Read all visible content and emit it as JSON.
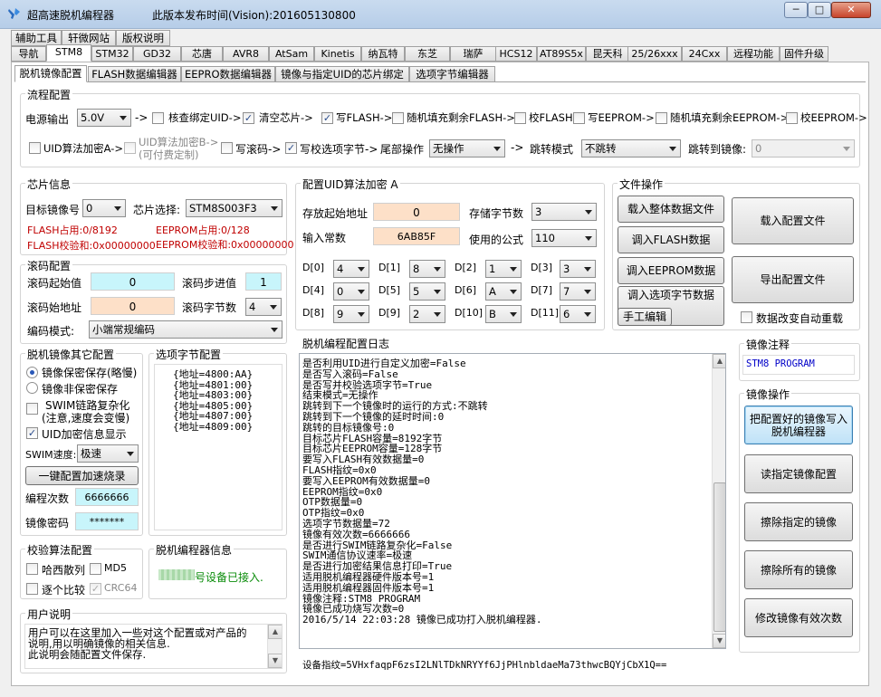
{
  "window": {
    "title": "超高速脱机编程器",
    "vision": "此版本发布时间(Vision):201605130800",
    "minimize": "─",
    "maximize": "□",
    "close": "✕"
  },
  "tabs_row1": [
    "辅助工具",
    "轩微网站",
    "版权说明"
  ],
  "tabs_row2": [
    "导航",
    "STM8",
    "STM32",
    "GD32",
    "芯唐",
    "AVR8",
    "AtSam",
    "Kinetis",
    "纳瓦特",
    "东芝",
    "瑞萨",
    "HCS12",
    "AT89S5x",
    "昆天科",
    "25/26xxx",
    "24Cxx",
    "远程功能",
    "固件升级"
  ],
  "tabs_row3": [
    "脱机镜像配置",
    "FLASH数据编辑器",
    "EEPRO数据编辑器",
    "镜像与指定UID的芯片绑定",
    "选项字节编辑器"
  ],
  "flow": {
    "title": "流程配置",
    "power_label": "电源输出",
    "power_value": "5.0V",
    "arrow": "->",
    "steps_row1": [
      {
        "label": "核查绑定UID->",
        "checked": false
      },
      {
        "label": "清空芯片->",
        "checked": true
      },
      {
        "label": "写FLASH->",
        "checked": true
      },
      {
        "label": "随机填充剩余FLASH->",
        "checked": false
      },
      {
        "label": "校FLASH->",
        "checked": false
      },
      {
        "label": "写EEPROM->",
        "checked": false
      },
      {
        "label": "随机填充剩余EEPROM->",
        "checked": false
      },
      {
        "label": "校EEPROM->",
        "checked": false
      }
    ],
    "uid_encrypt_a": "UID算法加密A->",
    "uid_encrypt_b_line1": "UID算法加密B->",
    "uid_encrypt_b_line2": "(可付费定制)",
    "write_roll": "写滚码->",
    "write_option": "写校选项字节->",
    "tail_label": "尾部操作",
    "tail_value": "无操作",
    "jump_mode_label": "跳转模式",
    "jump_mode_value": "不跳转",
    "jump_to_label": "跳转到镜像:",
    "jump_to_value": "0"
  },
  "chip": {
    "title": "芯片信息",
    "target_label": "目标镜像号",
    "target_value": "0",
    "chip_label": "芯片选择:",
    "chip_value": "STM8S003F3",
    "flash_used": "FLASH占用:0/8192",
    "eeprom_used": "EEPROM占用:0/128",
    "flash_checksum": "FLASH校验和:0x00000000",
    "eeprom_checksum": "EEPROM校验和:0x00000000"
  },
  "rolling": {
    "title": "滚码配置",
    "start_label": "滚码起始值",
    "start_value": "0",
    "step_label": "滚码步进值",
    "step_value": "1",
    "addr_label": "滚码始地址",
    "addr_value": "0",
    "bytes_label": "滚码字节数",
    "bytes_value": "4",
    "mode_label": "编码模式:",
    "mode_value": "小端常规编码"
  },
  "uid_cfg": {
    "title": "配置UID算法加密 A",
    "addr_label": "存放起始地址",
    "addr_value": "0",
    "bytes_label": "存储字节数",
    "bytes_value": "3",
    "const_label": "输入常数",
    "const_value": "6AB85F",
    "formula_label": "使用的公式",
    "formula_value": "110",
    "d": [
      {
        "label": "D[0]",
        "value": "4"
      },
      {
        "label": "D[1]",
        "value": "8"
      },
      {
        "label": "D[2]",
        "value": "1"
      },
      {
        "label": "D[3]",
        "value": "3"
      },
      {
        "label": "D[4]",
        "value": "0"
      },
      {
        "label": "D[5]",
        "value": "5"
      },
      {
        "label": "D[6]",
        "value": "A"
      },
      {
        "label": "D[7]",
        "value": "7"
      },
      {
        "label": "D[8]",
        "value": "9"
      },
      {
        "label": "D[9]",
        "value": "2"
      },
      {
        "label": "D[10]",
        "value": "B"
      },
      {
        "label": "D[11]",
        "value": "6"
      }
    ]
  },
  "file_ops": {
    "title": "文件操作",
    "load_all": "载入整体数据文件",
    "load_flash": "调入FLASH数据",
    "load_eeprom": "调入EEPROM数据",
    "load_option": "调入选项字节数据",
    "manual_edit": "手工编辑",
    "load_config": "载入配置文件",
    "export_config": "导出配置文件",
    "auto_reload": "数据改变自动重载"
  },
  "other": {
    "title": "脱机镜像其它配置",
    "keep_protect": "镜像保密保存(略慢)",
    "no_protect": "镜像非保密保存",
    "swim_line1": "SWIM链路复杂化",
    "swim_line2": "(注意,速度会变慢)",
    "uid_show": "UID加密信息显示",
    "swim_speed_label": "SWIM速度:",
    "swim_speed_value": "极速",
    "one_key": "一键配置加速烧录",
    "count_label": "编程次数",
    "count_value": "6666666",
    "pwd_label": "镜像密码",
    "pwd_value": "*******"
  },
  "option_bytes": {
    "title": "选项字节配置",
    "lines": [
      "{地址=4800:AA}",
      "{地址=4801:00}",
      "{地址=4803:00}",
      "{地址=4805:00}",
      "{地址=4807:00}",
      "{地址=4809:00}"
    ]
  },
  "log": {
    "title": "脱机编程配置日志",
    "lines": [
      "是否利用UID进行自定义加密=False",
      "是否写入滚码=False",
      "是否写并校验选项字节=True",
      "结束模式=无操作",
      "跳转到下一个镜像时的运行的方式:不跳转",
      "跳转到下一个镜像的延时时间:0",
      "跳转的目标镜像号:0",
      "目标芯片FLASH容量=8192字节",
      "目标芯片EEPROM容量=128字节",
      "要写入FLASH有效数据量=0",
      "FLASH指纹=0x0",
      "要写入EEPROM有效数据量=0",
      "EEPROM指纹=0x0",
      "OTP数据量=0",
      "OTP指纹=0x0",
      "选项字节数据量=72",
      "镜像有效次数=6666666",
      "是否进行SWIM链路复杂化=False",
      "SWIM通信协议速率=极速",
      "是否进行加密结果信息打印=True",
      "适用脱机编程器硬件版本号=1",
      "适用脱机编程器固件版本号=1",
      "镜像注释:STM8 PROGRAM",
      "镜像已成功烧写次数=0",
      "2016/5/14 22:03:28 镜像已成功打入脱机编程器."
    ],
    "fingerprint": "设备指纹=5VHxfaqpF6zsI2LNlTDkNRYYf6JjPHlnbldaeMa73thwcBQYjCbX1Q=="
  },
  "verify": {
    "title": "校验算法配置",
    "hash": "哈西散列",
    "md5": "MD5",
    "compare": "逐个比较",
    "crc64": "CRC64"
  },
  "programmer": {
    "title": "脱机编程器信息",
    "status": "号设备已接入."
  },
  "usage": {
    "title": "用户说明",
    "lines": [
      "用户可以在这里加入一些对这个配置或对产品的",
      "说明,用以明确镜像的相关信息.",
      "此说明会随配置文件保存."
    ]
  },
  "image_note": {
    "title": "镜像注释",
    "value": "STM8 PROGRAM"
  },
  "image_ops": {
    "title": "镜像操作",
    "write_line1": "把配置好的镜像写入",
    "write_line2": "脱机编程器",
    "read": "读指定镜像配置",
    "erase_one": "擦除指定的镜像",
    "erase_all": "擦除所有的镜像",
    "modify_count": "修改镜像有效次数"
  }
}
